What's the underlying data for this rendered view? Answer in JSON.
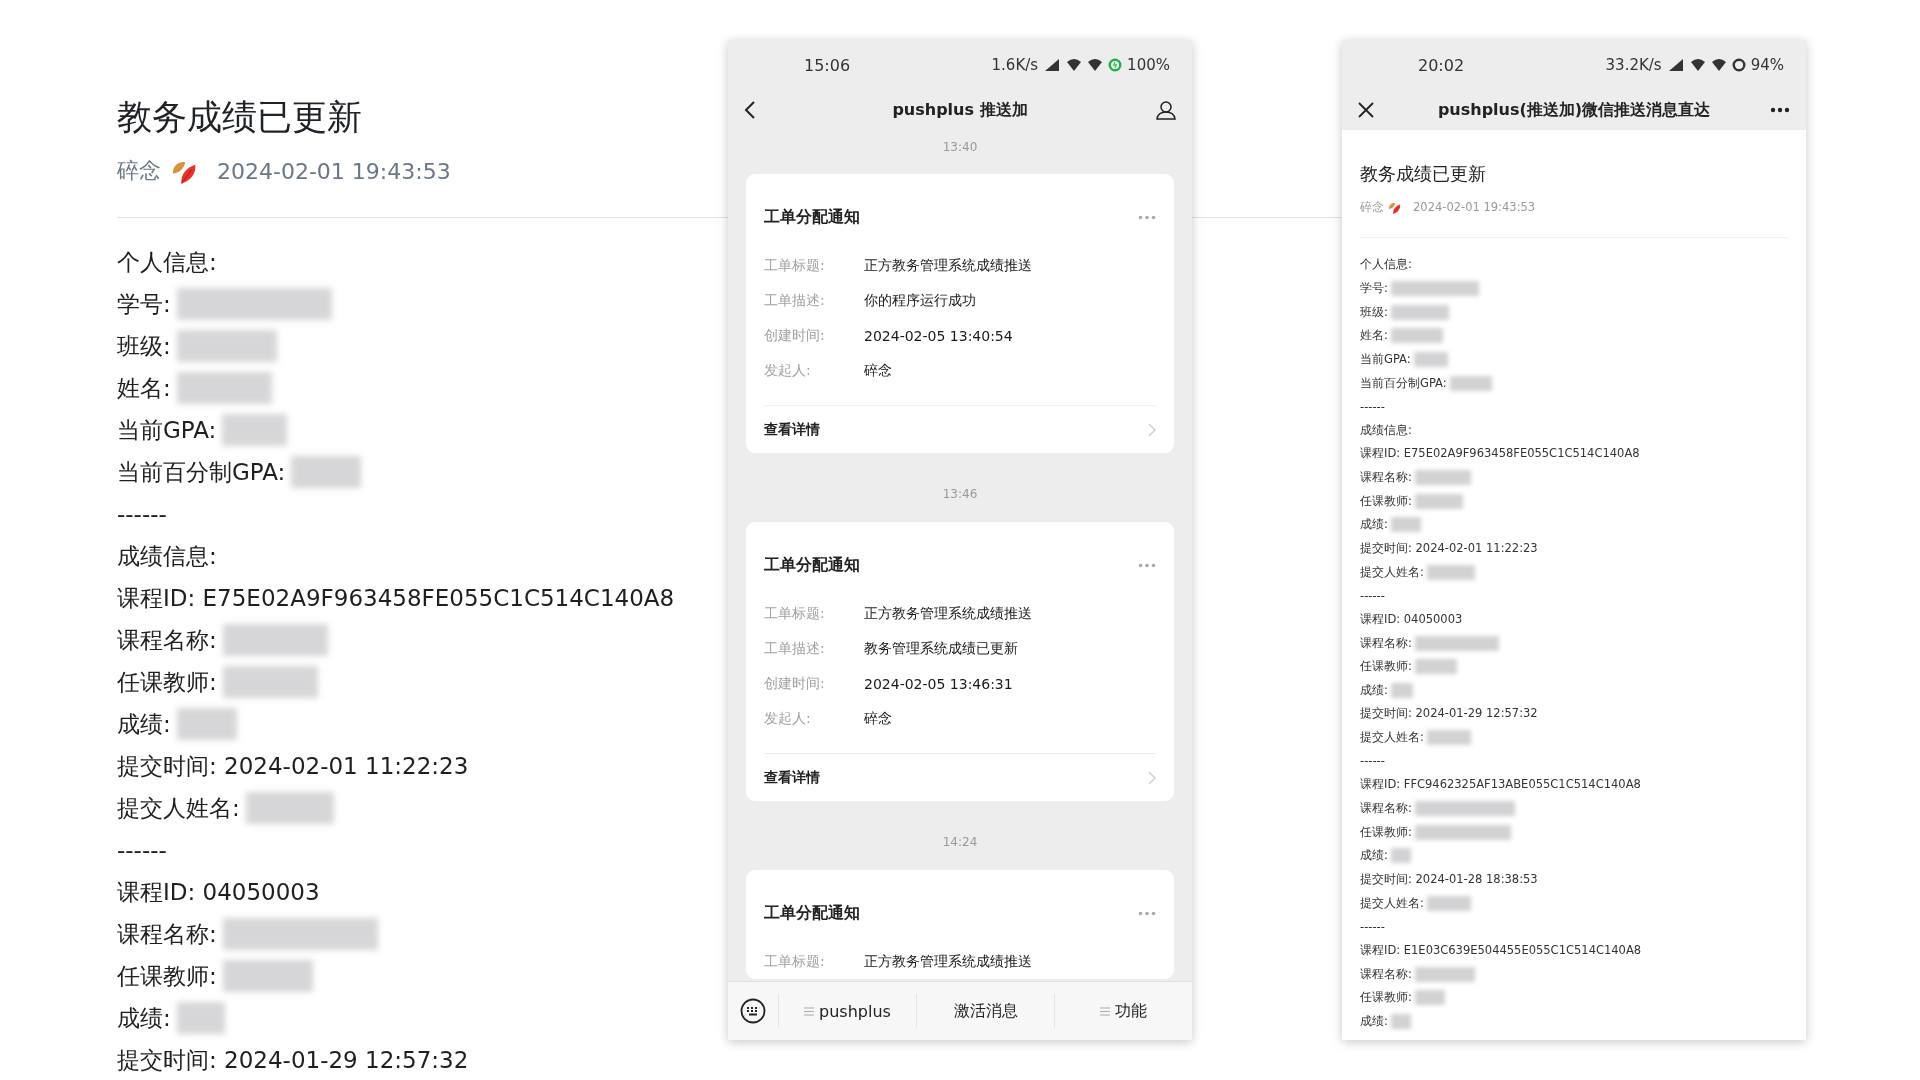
{
  "document": {
    "title": "教务成绩已更新",
    "author": "碎念",
    "timestamp": "2024-02-01 19:43:53",
    "lines": [
      {
        "text": "个人信息:",
        "redacted": false
      },
      {
        "text": "学号:",
        "redacted": true
      },
      {
        "text": "班级:",
        "redacted": true
      },
      {
        "text": "姓名:",
        "redacted": true
      },
      {
        "text": "当前GPA:",
        "redacted": true
      },
      {
        "text": "当前百分制GPA:",
        "redacted": true
      },
      {
        "text": "------",
        "redacted": false
      },
      {
        "text": "成绩信息:",
        "redacted": false
      },
      {
        "text": "课程ID: E75E02A9F963458FE055C1C514C140A8",
        "redacted": false
      },
      {
        "text": "课程名称:",
        "redacted": true
      },
      {
        "text": "任课教师:",
        "redacted": true
      },
      {
        "text": "成绩:",
        "redacted": true
      },
      {
        "text": "提交时间: 2024-02-01 11:22:23",
        "redacted": false
      },
      {
        "text": "提交人姓名:",
        "redacted": true
      },
      {
        "text": "------",
        "redacted": false
      },
      {
        "text": "课程ID: 04050003",
        "redacted": false
      },
      {
        "text": "课程名称:",
        "redacted": true
      },
      {
        "text": "任课教师:",
        "redacted": true
      },
      {
        "text": "成绩:",
        "redacted": true
      },
      {
        "text": "提交时间: 2024-01-29 12:57:32",
        "redacted": false
      }
    ]
  },
  "phones": [
    {
      "kind": "chat",
      "status_bar": {
        "time": "15:06",
        "speed": "1.6K/s",
        "battery": "100%",
        "charging": true
      },
      "nav": {
        "left": {
          "kind": "back"
        },
        "title": "pushplus 推送加",
        "right": {
          "kind": "profile"
        }
      },
      "messages": [
        {
          "time": "13:40",
          "card": {
            "title": "工单分配通知",
            "fields": [
              {
                "label": "工单标题:",
                "value": "正方教务管理系统成绩推送"
              },
              {
                "label": "工单描述:",
                "value": "你的程序运行成功"
              },
              {
                "label": "创建时间:",
                "value": "2024-02-05 13:40:54"
              },
              {
                "label": "发起人:",
                "value": "碎念"
              }
            ],
            "link": "查看详情"
          }
        },
        {
          "time": "13:46",
          "card": {
            "title": "工单分配通知",
            "fields": [
              {
                "label": "工单标题:",
                "value": "正方教务管理系统成绩推送"
              },
              {
                "label": "工单描述:",
                "value": "教务管理系统成绩已更新"
              },
              {
                "label": "创建时间:",
                "value": "2024-02-05 13:46:31"
              },
              {
                "label": "发起人:",
                "value": "碎念"
              }
            ],
            "link": "查看详情"
          }
        },
        {
          "time": "14:24",
          "card": {
            "title": "工单分配通知",
            "fields": [
              {
                "label": "工单标题:",
                "value": "正方教务管理系统成绩推送"
              }
            ]
          }
        }
      ],
      "bottom_bar": [
        {
          "text": "pushplus",
          "has_menu": true
        },
        {
          "text": "激活消息",
          "has_menu": false
        },
        {
          "text": "功能",
          "has_menu": true
        }
      ]
    },
    {
      "kind": "article",
      "status_bar": {
        "time": "20:02",
        "speed": "33.2K/s",
        "battery": "94%",
        "charging": false
      },
      "nav": {
        "left": {
          "kind": "close"
        },
        "title": "pushplus(推送加)微信推送消息直达",
        "right": {
          "kind": "more"
        }
      },
      "article": {
        "title": "教务成绩已更新",
        "author": "碎念",
        "timestamp": "2024-02-01 19:43:53",
        "lines": [
          {
            "text": "个人信息:",
            "redacted": false
          },
          {
            "text": "学号:",
            "redacted": true
          },
          {
            "text": "班级:",
            "redacted": true
          },
          {
            "text": "姓名:",
            "redacted": true
          },
          {
            "text": "当前GPA:",
            "redacted": true
          },
          {
            "text": "当前百分制GPA:",
            "redacted": true
          },
          {
            "text": "------",
            "redacted": false
          },
          {
            "text": "成绩信息:",
            "redacted": false
          },
          {
            "text": "课程ID: E75E02A9F963458FE055C1C514C140A8",
            "redacted": false
          },
          {
            "text": "课程名称:",
            "redacted": true
          },
          {
            "text": "任课教师:",
            "redacted": true
          },
          {
            "text": "成绩:",
            "redacted": true
          },
          {
            "text": "提交时间: 2024-02-01 11:22:23",
            "redacted": false
          },
          {
            "text": "提交人姓名:",
            "redacted": true
          },
          {
            "text": "------",
            "redacted": false
          },
          {
            "text": "课程ID: 04050003",
            "redacted": false
          },
          {
            "text": "课程名称:",
            "redacted": true
          },
          {
            "text": "任课教师:",
            "redacted": true
          },
          {
            "text": "成绩:",
            "redacted": true
          },
          {
            "text": "提交时间: 2024-01-29 12:57:32",
            "redacted": false
          },
          {
            "text": "提交人姓名:",
            "redacted": true
          },
          {
            "text": "------",
            "redacted": false
          },
          {
            "text": "课程ID: FFC9462325AF13ABE055C1C514C140A8",
            "redacted": false
          },
          {
            "text": "课程名称:",
            "redacted": true
          },
          {
            "text": "任课教师:",
            "redacted": true
          },
          {
            "text": "成绩:",
            "redacted": true
          },
          {
            "text": "提交时间: 2024-01-28 18:38:53",
            "redacted": false
          },
          {
            "text": "提交人姓名:",
            "redacted": true
          },
          {
            "text": "------",
            "redacted": false
          },
          {
            "text": "课程ID: E1E03C639E504455E055C1C514C140A8",
            "redacted": false
          },
          {
            "text": "课程名称:",
            "redacted": true
          },
          {
            "text": "任课教师:",
            "redacted": true
          },
          {
            "text": "成绩:",
            "redacted": true
          }
        ]
      }
    }
  ]
}
